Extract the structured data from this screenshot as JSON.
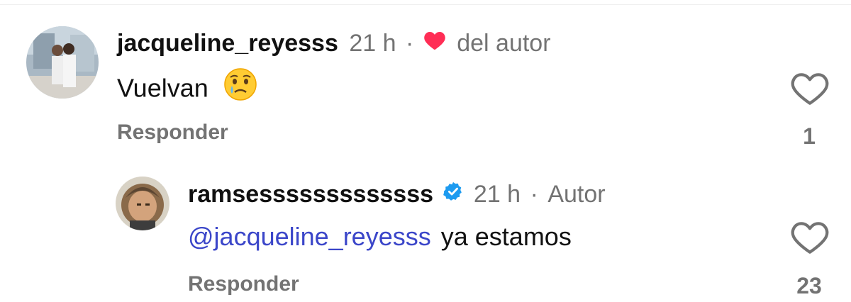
{
  "comments": [
    {
      "username": "jacqueline_reyesss",
      "time": "21 h",
      "separator": "·",
      "author_liked_text": "del autor",
      "text": "Vuelvan",
      "reply_label": "Responder",
      "like_count": "1"
    }
  ],
  "reply": {
    "username": "ramsesssssssssssss",
    "verified": true,
    "time": "21 h",
    "separator": "·",
    "badge": "Autor",
    "mention": "@jacqueline_reyesss",
    "text": "ya estamos",
    "reply_label": "Responder",
    "like_count": "23"
  },
  "colors": {
    "verified_blue": "#1d9bf0",
    "like_red": "#ff2d55",
    "mention": "#3b46c9",
    "muted": "#737373"
  },
  "icons": {
    "liked_by_author": "heart-filled-icon",
    "like": "heart-outline-icon",
    "verified": "verified-badge-icon",
    "emoji": "crying-face-emoji"
  }
}
